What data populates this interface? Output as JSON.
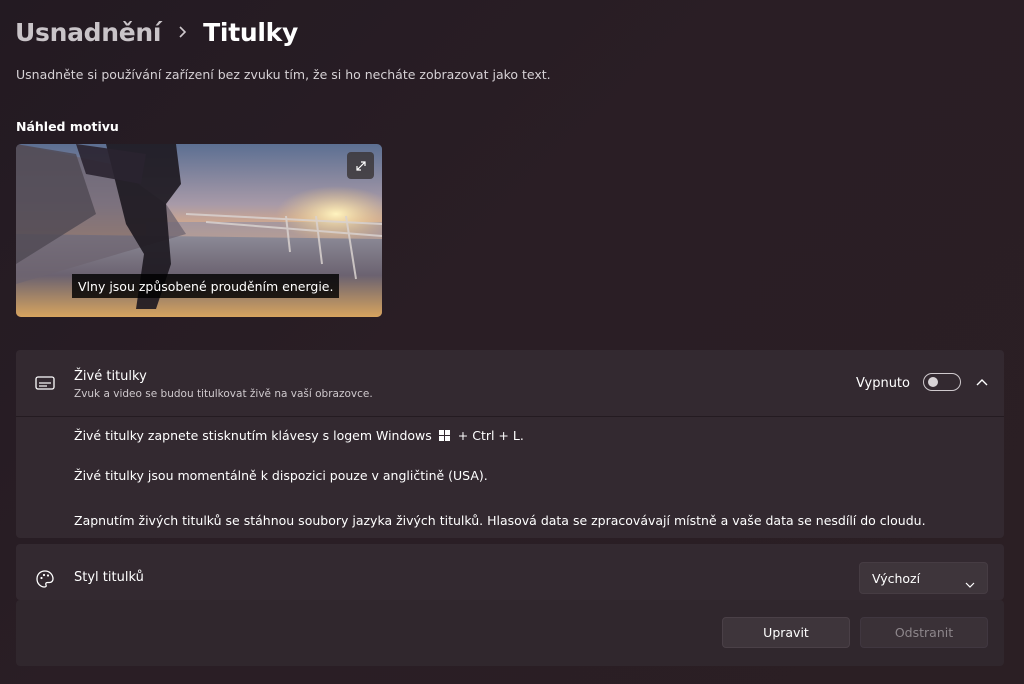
{
  "breadcrumb": {
    "parent": "Usnadnění",
    "current": "Titulky"
  },
  "description": "Usnadněte si používání zařízení bez zvuku tím, že si ho necháte zobrazovat jako text.",
  "preview": {
    "section_title": "Náhled motivu",
    "caption": "Vlny jsou způsobené prouděním energie.",
    "expand_icon": "expand-icon"
  },
  "live_captions": {
    "icon": "captions-icon",
    "title": "Živé titulky",
    "subtitle": "Zvuk a video se budou titulkovat živě na vaší obrazovce.",
    "toggle_label": "Vypnuto",
    "toggle_on": false,
    "line1_before": "Živé titulky zapnete stisknutím klávesy s logem Windows",
    "line1_after": "+ Ctrl + L.",
    "line2": "Živé titulky jsou momentálně k dispozici pouze v angličtině (USA).",
    "line3": "Zapnutím živých titulků se stáhnou soubory jazyka živých titulků. Hlasová data se zpracovávají místně a vaše data se nesdílí do cloudu."
  },
  "caption_style": {
    "icon": "palette-icon",
    "title": "Styl titulků",
    "selected": "Výchozí",
    "edit_label": "Upravit",
    "remove_label": "Odstranit",
    "remove_enabled": false
  },
  "colors": {
    "background": "#2a1e25",
    "card": "#332930",
    "text": "#ffffff",
    "disabled_text": "#8d868b"
  }
}
